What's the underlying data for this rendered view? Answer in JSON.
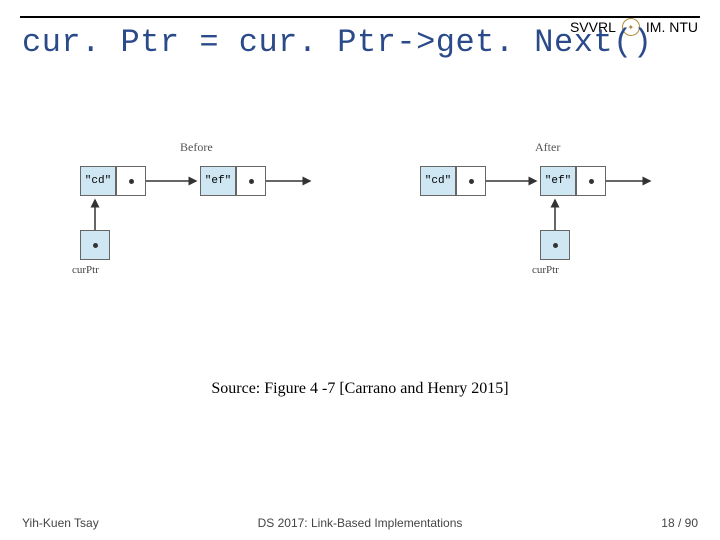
{
  "header": {
    "org_left": "SVVRL",
    "org_right": "IM. NTU"
  },
  "title": "cur. Ptr = cur. Ptr->get. Next()",
  "diagram": {
    "before_label": "Before",
    "after_label": "After",
    "node1_value": "\"cd\"",
    "node2_value": "\"ef\"",
    "curptr_label": "curPtr"
  },
  "source": "Source: Figure 4 -7 [Carrano and Henry 2015]",
  "footer": {
    "author": "Yih-Kuen Tsay",
    "course": "DS 2017: Link-Based Implementations",
    "page": "18 / 90"
  }
}
